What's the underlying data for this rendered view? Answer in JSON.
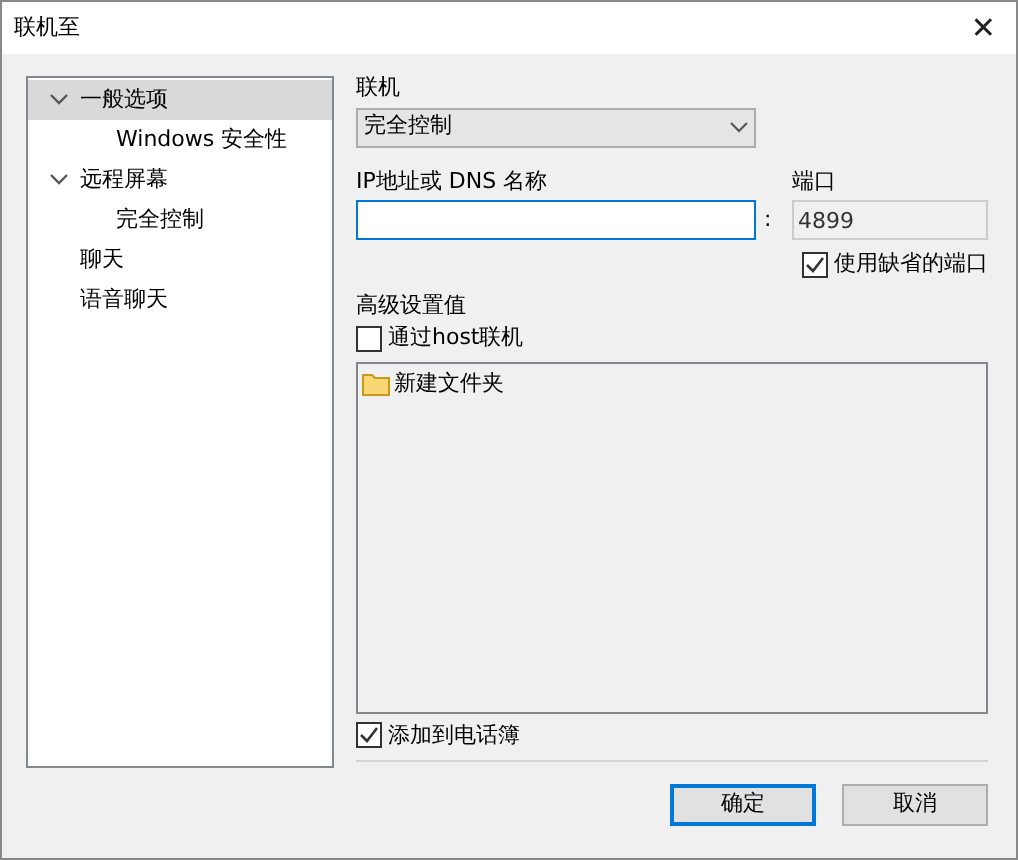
{
  "window": {
    "title": "联机至",
    "close": "✕"
  },
  "tree": [
    {
      "label": "一般选项",
      "expanded": true,
      "selected": true,
      "children": [
        {
          "label": "Windows 安全性",
          "selected": false
        }
      ]
    },
    {
      "label": "远程屏幕",
      "expanded": true,
      "selected": false,
      "children": [
        {
          "label": "完全控制",
          "selected": false
        }
      ]
    },
    {
      "label": "聊天",
      "selected": false
    },
    {
      "label": "语音聊天",
      "selected": false
    }
  ],
  "connection": {
    "label": "联机",
    "value": "完全控制"
  },
  "address": {
    "label": "IP地址或 DNS 名称"
  },
  "port": {
    "label": "端口",
    "separator": ":",
    "value": "4899",
    "disabled": true
  },
  "use_default_port": {
    "label": "使用缺省的端口",
    "checked": true
  },
  "advanced": {
    "label": "高级设置值"
  },
  "via_host": {
    "label": "通过host联机",
    "checked": false
  },
  "folders": [
    {
      "label": "新建文件夹"
    }
  ],
  "add_to_phonebook": {
    "label": "添加到电话簿",
    "checked": true
  },
  "buttons": [
    {
      "label": "确定",
      "default": true
    },
    {
      "label": "取消",
      "default": false
    }
  ]
}
